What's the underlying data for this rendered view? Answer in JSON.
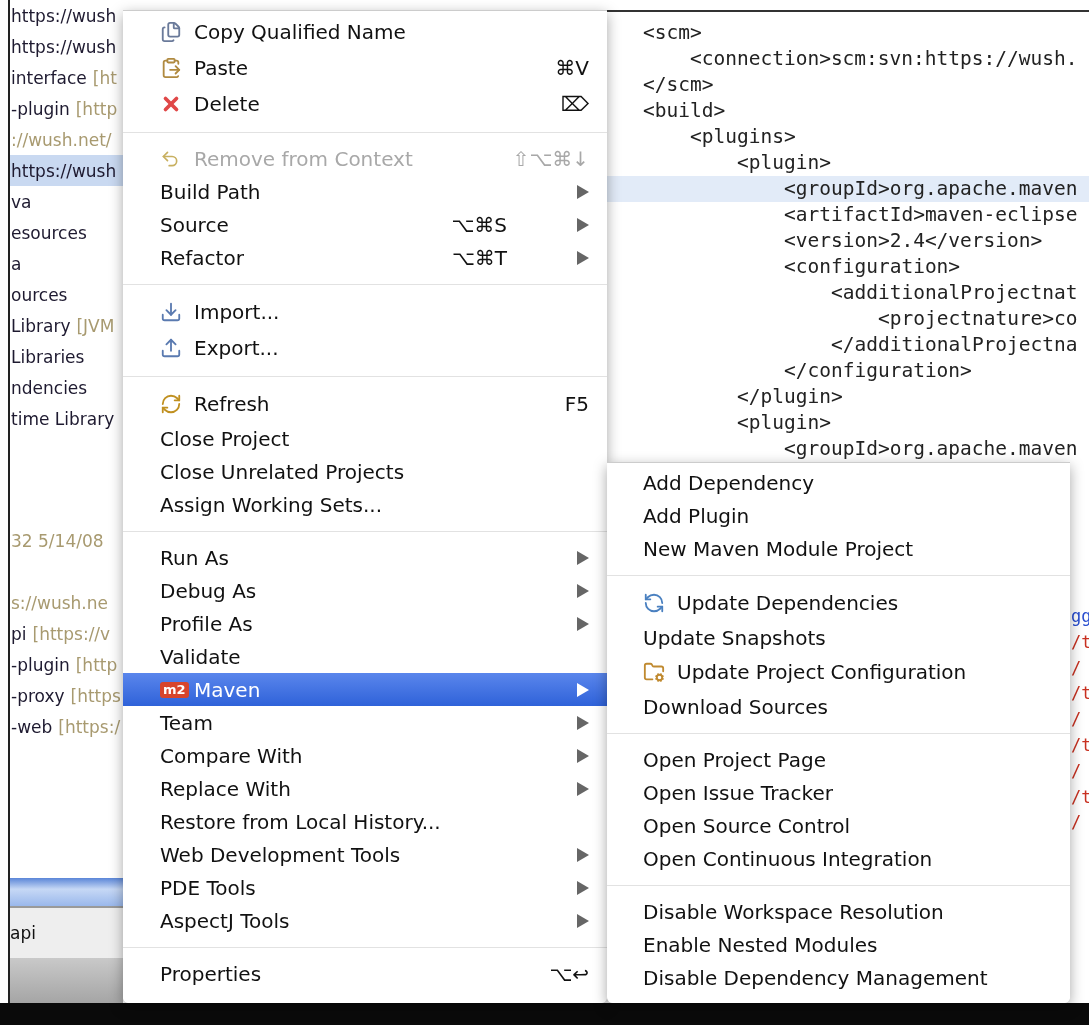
{
  "project_tree": {
    "sections": [
      {
        "items": [
          {
            "name": "https://wush",
            "selected": false
          },
          {
            "name": "https://wush",
            "selected": false
          },
          {
            "name": "interface",
            "detail": "[ht",
            "selected": false
          },
          {
            "name": "-plugin",
            "detail": "[http",
            "selected": false
          },
          {
            "detail": "://wush.net/",
            "selected": false
          },
          {
            "name": "https://wush",
            "selected": true
          },
          {
            "name": "va",
            "selected": false
          },
          {
            "name": "esources",
            "selected": false
          },
          {
            "name": "a",
            "selected": false
          },
          {
            "name": "ources",
            "selected": false
          },
          {
            "name": "Library",
            "detail": "[JVM",
            "selected": false
          },
          {
            "name": "Libraries",
            "selected": false
          },
          {
            "name": "ndencies",
            "selected": false
          },
          {
            "name": "time Library",
            "selected": false
          }
        ]
      },
      {
        "items": [
          {
            "detail": "32  5/14/08",
            "selected": false
          }
        ]
      },
      {
        "items": [
          {
            "detail": "s://wush.ne",
            "selected": false
          },
          {
            "name": "pi",
            "detail": "[https://v",
            "selected": false
          },
          {
            "name": "-plugin",
            "detail": "[http",
            "selected": false
          },
          {
            "name": "-proxy",
            "detail": "[https",
            "selected": false
          },
          {
            "name": "-web",
            "detail": "[https:/",
            "selected": false
          }
        ]
      }
    ],
    "bottom_tab": "api"
  },
  "editor": {
    "lines": [
      {
        "text": "<scm>",
        "highlighted": false,
        "children": [
          {
            "text": "<connection>scm:svn:https://wush.",
            "highlighted": false
          }
        ]
      },
      {
        "text": "</scm>",
        "highlighted": false
      },
      {
        "text": "<build>",
        "highlighted": false,
        "children": [
          {
            "text": "<plugins>",
            "highlighted": false,
            "children": [
              {
                "text": "<plugin>",
                "highlighted": false,
                "children": [
                  {
                    "text": "<groupId>org.apache.maven",
                    "highlighted": true
                  },
                  {
                    "text": "<artifactId>maven-eclipse",
                    "highlighted": false
                  },
                  {
                    "text": "<version>2.4</version>",
                    "highlighted": false
                  },
                  {
                    "text": "<configuration>",
                    "highlighted": false,
                    "children": [
                      {
                        "text": "<additionalProjectnat",
                        "highlighted": false,
                        "children": [
                          {
                            "text": "<projectnature>co",
                            "highlighted": false
                          }
                        ]
                      },
                      {
                        "text": "</additionalProjectna",
                        "highlighted": false
                      }
                    ]
                  },
                  {
                    "text": "</configuration>",
                    "highlighted": false
                  }
                ]
              },
              {
                "text": "</plugin>",
                "highlighted": false
              },
              {
                "text": "<plugin>",
                "highlighted": false,
                "children": [
                  {
                    "text": "<groupId>org.apache.maven",
                    "highlighted": false
                  }
                ]
              }
            ]
          }
        ]
      }
    ],
    "lower_pane_fragments": [
      {
        "text": "gg",
        "color": "#2a4fd0"
      },
      {
        "text": "/t",
        "color": "#c83020"
      },
      {
        "text": "/",
        "color": "#c83020"
      },
      {
        "text": "/t",
        "color": "#c83020"
      },
      {
        "text": "/",
        "color": "#c83020"
      },
      {
        "text": "/t",
        "color": "#c83020"
      },
      {
        "text": "/",
        "color": "#c83020"
      },
      {
        "text": "/t",
        "color": "#c83020"
      },
      {
        "text": "/",
        "color": "#c83020"
      }
    ]
  },
  "context_menu": {
    "items": [
      {
        "kind": "item",
        "label": "Copy Qualified Name",
        "selected": false,
        "disabled": false
      },
      {
        "kind": "item",
        "label": "Paste",
        "shortcut": "⌘V",
        "selected": false,
        "disabled": false
      },
      {
        "kind": "item",
        "label": "Delete",
        "shortcut": "⌦",
        "selected": false,
        "disabled": false
      },
      {
        "kind": "separator"
      },
      {
        "kind": "item",
        "label": "Remove from Context",
        "shortcut": "⇧⌥⌘↓",
        "selected": false,
        "disabled": true
      },
      {
        "kind": "item",
        "label": "Build Path",
        "submenu": true,
        "selected": false,
        "disabled": false
      },
      {
        "kind": "item",
        "label": "Source",
        "shortcut": "⌥⌘S",
        "submenu": true,
        "selected": false,
        "disabled": false
      },
      {
        "kind": "item",
        "label": "Refactor",
        "shortcut": "⌥⌘T",
        "submenu": true,
        "selected": false,
        "disabled": false
      },
      {
        "kind": "separator"
      },
      {
        "kind": "item",
        "label": "Import...",
        "selected": false,
        "disabled": false
      },
      {
        "kind": "item",
        "label": "Export...",
        "selected": false,
        "disabled": false
      },
      {
        "kind": "separator"
      },
      {
        "kind": "item",
        "label": "Refresh",
        "shortcut": "F5",
        "selected": false,
        "disabled": false
      },
      {
        "kind": "item",
        "label": "Close Project",
        "selected": false,
        "disabled": false
      },
      {
        "kind": "item",
        "label": "Close Unrelated Projects",
        "selected": false,
        "disabled": false
      },
      {
        "kind": "item",
        "label": "Assign Working Sets...",
        "selected": false,
        "disabled": false
      },
      {
        "kind": "separator"
      },
      {
        "kind": "item",
        "label": "Run As",
        "submenu": true,
        "selected": false,
        "disabled": false
      },
      {
        "kind": "item",
        "label": "Debug As",
        "submenu": true,
        "selected": false,
        "disabled": false
      },
      {
        "kind": "item",
        "label": "Profile As",
        "submenu": true,
        "selected": false,
        "disabled": false
      },
      {
        "kind": "item",
        "label": "Validate",
        "selected": false,
        "disabled": false
      },
      {
        "kind": "item",
        "icon_text": "m2",
        "label": "Maven",
        "submenu": true,
        "selected": true,
        "disabled": false
      },
      {
        "kind": "item",
        "label": "Team",
        "submenu": true,
        "selected": false,
        "disabled": false
      },
      {
        "kind": "item",
        "label": "Compare With",
        "submenu": true,
        "selected": false,
        "disabled": false
      },
      {
        "kind": "item",
        "label": "Replace With",
        "submenu": true,
        "selected": false,
        "disabled": false
      },
      {
        "kind": "item",
        "label": "Restore from Local History...",
        "selected": false,
        "disabled": false
      },
      {
        "kind": "item",
        "label": "Web Development Tools",
        "submenu": true,
        "selected": false,
        "disabled": false
      },
      {
        "kind": "item",
        "label": "PDE Tools",
        "submenu": true,
        "selected": false,
        "disabled": false
      },
      {
        "kind": "item",
        "label": "AspectJ Tools",
        "submenu": true,
        "selected": false,
        "disabled": false
      },
      {
        "kind": "separator"
      },
      {
        "kind": "item",
        "label": "Properties",
        "shortcut": "⌥↩",
        "selected": false,
        "disabled": false
      }
    ]
  },
  "maven_submenu": {
    "items": [
      {
        "kind": "item",
        "label": "Add Dependency",
        "selected": false
      },
      {
        "kind": "item",
        "label": "Add Plugin",
        "selected": false
      },
      {
        "kind": "item",
        "label": "New Maven Module Project",
        "selected": false
      },
      {
        "kind": "separator"
      },
      {
        "kind": "item",
        "label": "Update Dependencies",
        "selected": false
      },
      {
        "kind": "item",
        "label": "Update Snapshots",
        "selected": false
      },
      {
        "kind": "item",
        "label": "Update Project Configuration",
        "selected": false
      },
      {
        "kind": "item",
        "label": "Download Sources",
        "selected": false
      },
      {
        "kind": "separator"
      },
      {
        "kind": "item",
        "label": "Open Project Page",
        "selected": false
      },
      {
        "kind": "item",
        "label": "Open Issue Tracker",
        "selected": false
      },
      {
        "kind": "item",
        "label": "Open Source Control",
        "selected": false
      },
      {
        "kind": "item",
        "label": "Open Continuous Integration",
        "selected": false
      },
      {
        "kind": "separator"
      },
      {
        "kind": "item",
        "label": "Disable Workspace Resolution",
        "selected": false
      },
      {
        "kind": "item",
        "label": "Enable Nested Modules",
        "selected": false
      },
      {
        "kind": "item",
        "label": "Disable Dependency Management",
        "selected": false
      }
    ]
  }
}
